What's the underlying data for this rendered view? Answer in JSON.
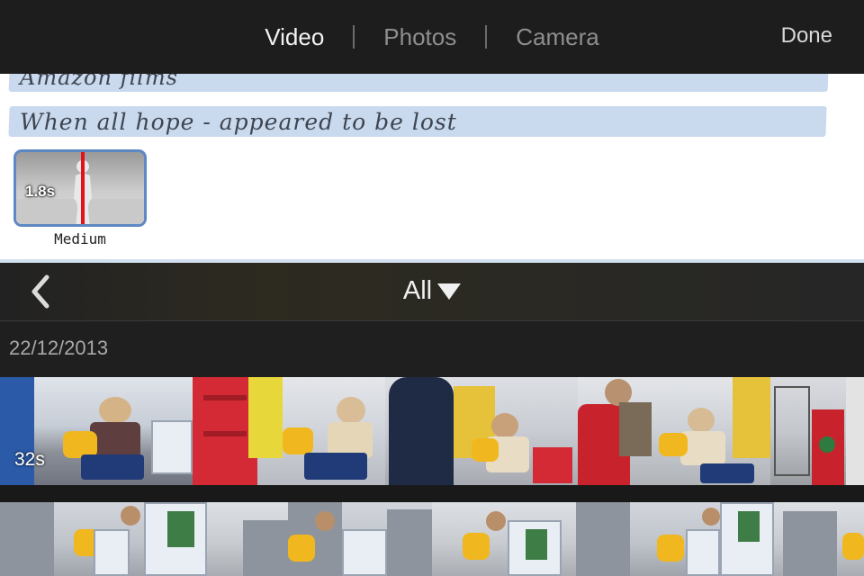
{
  "topbar": {
    "tabs": [
      {
        "label": "Video",
        "active": true
      },
      {
        "label": "Photos",
        "active": false
      },
      {
        "label": "Camera",
        "active": false
      }
    ],
    "done_label": "Done"
  },
  "editor": {
    "line_1": "Amazon films",
    "line_2": "When all hope - appeared to be lost",
    "duration_value": "1.8s",
    "duration_label": "Medium"
  },
  "browser": {
    "back_icon": "chevron-left-icon",
    "filter_label": "All",
    "filter_icon": "triangle-down-icon",
    "section_date": "22/12/2013",
    "clips": [
      {
        "duration": "32s"
      },
      {
        "duration": ""
      }
    ]
  },
  "colors": {
    "topbar_bg": "#1d1d1d",
    "accent_blue": "#5d88c2",
    "strip_blue": "#c9d9ee",
    "marker_red": "#e0121a"
  }
}
